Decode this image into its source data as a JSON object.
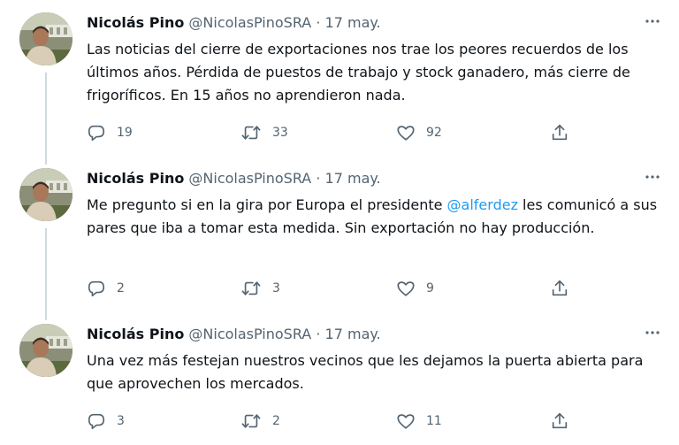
{
  "colors": {
    "text": "#0f1419",
    "secondary": "#536471",
    "link": "#1d9bf0",
    "thread_line": "#cfd9de"
  },
  "icons": {
    "reply": "reply-icon",
    "retweet": "retweet-icon",
    "like": "like-icon",
    "share": "share-icon",
    "more": "more-icon"
  },
  "tweets": [
    {
      "author_name": "Nicolás Pino",
      "handle": "@NicolasPinoSRA",
      "separator": "·",
      "date": "17 may.",
      "text_before": "Las noticias del cierre de exportaciones nos trae los peores recuerdos de los últimos años. Pérdida de puestos de trabajo y stock ganadero, más cierre de frigoríficos. En 15 años no aprendieron nada.",
      "mention": "",
      "text_after": "",
      "replies": "19",
      "retweets": "33",
      "likes": "92"
    },
    {
      "author_name": "Nicolás Pino",
      "handle": "@NicolasPinoSRA",
      "separator": "·",
      "date": "17 may.",
      "text_before": "Me pregunto si en la gira por Europa el presidente ",
      "mention": "@alferdez",
      "text_after": " les comunicó a sus pares que iba a tomar esta medida. Sin exportación no hay producción.",
      "replies": "2",
      "retweets": "3",
      "likes": "9"
    },
    {
      "author_name": "Nicolás Pino",
      "handle": "@NicolasPinoSRA",
      "separator": "·",
      "date": "17 may.",
      "text_before": "Una vez más festejan nuestros vecinos que les dejamos la puerta abierta para que aprovechen los mercados.",
      "mention": "",
      "text_after": "",
      "replies": "3",
      "retweets": "2",
      "likes": "11"
    }
  ]
}
